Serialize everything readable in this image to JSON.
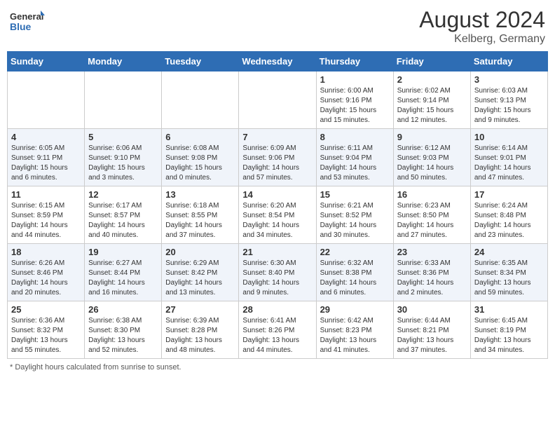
{
  "header": {
    "logo_general": "General",
    "logo_blue": "Blue",
    "month_year": "August 2024",
    "location": "Kelberg, Germany"
  },
  "days_header": [
    "Sunday",
    "Monday",
    "Tuesday",
    "Wednesday",
    "Thursday",
    "Friday",
    "Saturday"
  ],
  "footer_note": "Daylight hours",
  "weeks": [
    {
      "cells": [
        {
          "empty": true
        },
        {
          "empty": true
        },
        {
          "empty": true
        },
        {
          "empty": true
        },
        {
          "day": "1",
          "sunrise": "6:00 AM",
          "sunset": "9:16 PM",
          "daylight": "15 hours and 15 minutes."
        },
        {
          "day": "2",
          "sunrise": "6:02 AM",
          "sunset": "9:14 PM",
          "daylight": "15 hours and 12 minutes."
        },
        {
          "day": "3",
          "sunrise": "6:03 AM",
          "sunset": "9:13 PM",
          "daylight": "15 hours and 9 minutes."
        }
      ]
    },
    {
      "cells": [
        {
          "day": "4",
          "sunrise": "6:05 AM",
          "sunset": "9:11 PM",
          "daylight": "15 hours and 6 minutes."
        },
        {
          "day": "5",
          "sunrise": "6:06 AM",
          "sunset": "9:10 PM",
          "daylight": "15 hours and 3 minutes."
        },
        {
          "day": "6",
          "sunrise": "6:08 AM",
          "sunset": "9:08 PM",
          "daylight": "15 hours and 0 minutes."
        },
        {
          "day": "7",
          "sunrise": "6:09 AM",
          "sunset": "9:06 PM",
          "daylight": "14 hours and 57 minutes."
        },
        {
          "day": "8",
          "sunrise": "6:11 AM",
          "sunset": "9:04 PM",
          "daylight": "14 hours and 53 minutes."
        },
        {
          "day": "9",
          "sunrise": "6:12 AM",
          "sunset": "9:03 PM",
          "daylight": "14 hours and 50 minutes."
        },
        {
          "day": "10",
          "sunrise": "6:14 AM",
          "sunset": "9:01 PM",
          "daylight": "14 hours and 47 minutes."
        }
      ]
    },
    {
      "cells": [
        {
          "day": "11",
          "sunrise": "6:15 AM",
          "sunset": "8:59 PM",
          "daylight": "14 hours and 44 minutes."
        },
        {
          "day": "12",
          "sunrise": "6:17 AM",
          "sunset": "8:57 PM",
          "daylight": "14 hours and 40 minutes."
        },
        {
          "day": "13",
          "sunrise": "6:18 AM",
          "sunset": "8:55 PM",
          "daylight": "14 hours and 37 minutes."
        },
        {
          "day": "14",
          "sunrise": "6:20 AM",
          "sunset": "8:54 PM",
          "daylight": "14 hours and 34 minutes."
        },
        {
          "day": "15",
          "sunrise": "6:21 AM",
          "sunset": "8:52 PM",
          "daylight": "14 hours and 30 minutes."
        },
        {
          "day": "16",
          "sunrise": "6:23 AM",
          "sunset": "8:50 PM",
          "daylight": "14 hours and 27 minutes."
        },
        {
          "day": "17",
          "sunrise": "6:24 AM",
          "sunset": "8:48 PM",
          "daylight": "14 hours and 23 minutes."
        }
      ]
    },
    {
      "cells": [
        {
          "day": "18",
          "sunrise": "6:26 AM",
          "sunset": "8:46 PM",
          "daylight": "14 hours and 20 minutes."
        },
        {
          "day": "19",
          "sunrise": "6:27 AM",
          "sunset": "8:44 PM",
          "daylight": "14 hours and 16 minutes."
        },
        {
          "day": "20",
          "sunrise": "6:29 AM",
          "sunset": "8:42 PM",
          "daylight": "14 hours and 13 minutes."
        },
        {
          "day": "21",
          "sunrise": "6:30 AM",
          "sunset": "8:40 PM",
          "daylight": "14 hours and 9 minutes."
        },
        {
          "day": "22",
          "sunrise": "6:32 AM",
          "sunset": "8:38 PM",
          "daylight": "14 hours and 6 minutes."
        },
        {
          "day": "23",
          "sunrise": "6:33 AM",
          "sunset": "8:36 PM",
          "daylight": "14 hours and 2 minutes."
        },
        {
          "day": "24",
          "sunrise": "6:35 AM",
          "sunset": "8:34 PM",
          "daylight": "13 hours and 59 minutes."
        }
      ]
    },
    {
      "cells": [
        {
          "day": "25",
          "sunrise": "6:36 AM",
          "sunset": "8:32 PM",
          "daylight": "13 hours and 55 minutes."
        },
        {
          "day": "26",
          "sunrise": "6:38 AM",
          "sunset": "8:30 PM",
          "daylight": "13 hours and 52 minutes."
        },
        {
          "day": "27",
          "sunrise": "6:39 AM",
          "sunset": "8:28 PM",
          "daylight": "13 hours and 48 minutes."
        },
        {
          "day": "28",
          "sunrise": "6:41 AM",
          "sunset": "8:26 PM",
          "daylight": "13 hours and 44 minutes."
        },
        {
          "day": "29",
          "sunrise": "6:42 AM",
          "sunset": "8:23 PM",
          "daylight": "13 hours and 41 minutes."
        },
        {
          "day": "30",
          "sunrise": "6:44 AM",
          "sunset": "8:21 PM",
          "daylight": "13 hours and 37 minutes."
        },
        {
          "day": "31",
          "sunrise": "6:45 AM",
          "sunset": "8:19 PM",
          "daylight": "13 hours and 34 minutes."
        }
      ]
    }
  ]
}
